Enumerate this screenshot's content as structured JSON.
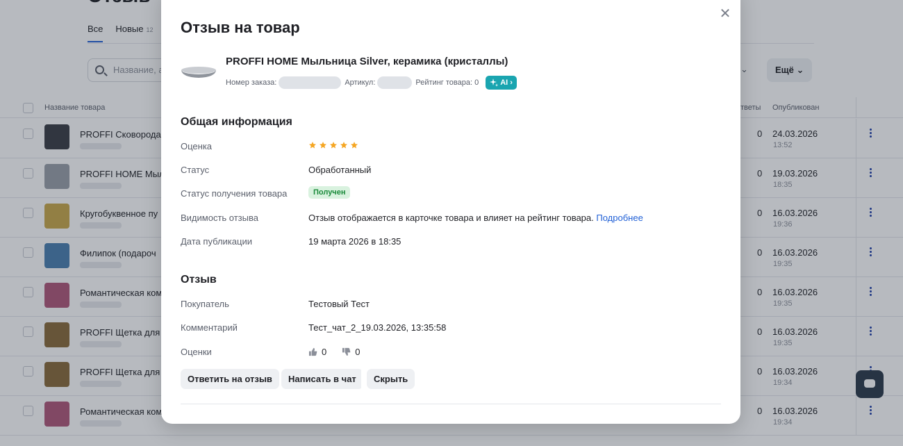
{
  "background": {
    "tabs": [
      {
        "label": "Все",
        "count": ""
      },
      {
        "label": "Новые",
        "count": "12"
      }
    ],
    "search_placeholder": "Название, а",
    "more_label": "Ещё",
    "table_headers": {
      "name": "Название товара",
      "answers": "тветы",
      "published": "Опубликован"
    },
    "rows": [
      {
        "name": "PROFFI Сковорода",
        "answers": "0",
        "date": "24.03.2026",
        "time": "13:52",
        "thumb_color": "#3a3d44"
      },
      {
        "name": "PROFFI HOME Мыл",
        "answers": "0",
        "date": "19.03.2026",
        "time": "18:35",
        "thumb_color": "#9aa0a8"
      },
      {
        "name": "Кругобуквенное пу",
        "answers": "0",
        "date": "16.03.2026",
        "time": "19:36",
        "thumb_color": "#c9a84a"
      },
      {
        "name": "Филипок (подароч",
        "answers": "0",
        "date": "16.03.2026",
        "time": "19:35",
        "thumb_color": "#4a7fb0"
      },
      {
        "name": "Романтическая ком",
        "answers": "0",
        "date": "16.03.2026",
        "time": "19:35",
        "thumb_color": "#b0577a"
      },
      {
        "name": "PROFFI Щетка для",
        "answers": "0",
        "date": "16.03.2026",
        "time": "19:35",
        "thumb_color": "#8a6a3a"
      },
      {
        "name": "PROFFI Щетка для",
        "answers": "0",
        "date": "16.03.2026",
        "time": "19:34",
        "thumb_color": "#8a6a3a"
      },
      {
        "name": "Романтическая ком",
        "answers": "0",
        "date": "16.03.2026",
        "time": "19:34",
        "thumb_color": "#b0577a"
      }
    ]
  },
  "modal": {
    "title": "Отзыв на товар",
    "close_glyph": "✕",
    "product": {
      "name": "PROFFI HOME Мыльница Silver, керамика (кристаллы)",
      "order_label": "Номер заказа:",
      "article_label": "Артикул:",
      "rating_label": "Рейтинг товара: 0",
      "ai_label": "AI",
      "ai_chevron": "›"
    },
    "general": {
      "title": "Общая информация",
      "rating_label": "Оценка",
      "rating_value": 5,
      "status_label": "Статус",
      "status_value": "Обработанный",
      "receipt_label": "Статус получения товара",
      "receipt_value": "Получен",
      "visibility_label": "Видимость отзыва",
      "visibility_value": "Отзыв отображается в карточке товара и влияет на рейтинг товара.",
      "visibility_link": "Подробнее",
      "date_label": "Дата публикации",
      "date_value": "19 марта 2026 в 18:35"
    },
    "review": {
      "title": "Отзыв",
      "buyer_label": "Покупатель",
      "buyer_value": "Тестовый Тест",
      "comment_label": "Комментарий",
      "comment_value": "Тест_чат_2_19.03.2026, 13:35:58",
      "votes_label": "Оценки",
      "likes": "0",
      "dislikes": "0"
    },
    "actions": {
      "reply": "Ответить на отзыв",
      "chat": "Написать в чат",
      "hide": "Скрыть"
    }
  },
  "colors": {
    "accent": "#1f5fd6",
    "star": "#f5a623",
    "ai_badge": "#1aa5b0",
    "status_green": "#1a8a3a"
  }
}
